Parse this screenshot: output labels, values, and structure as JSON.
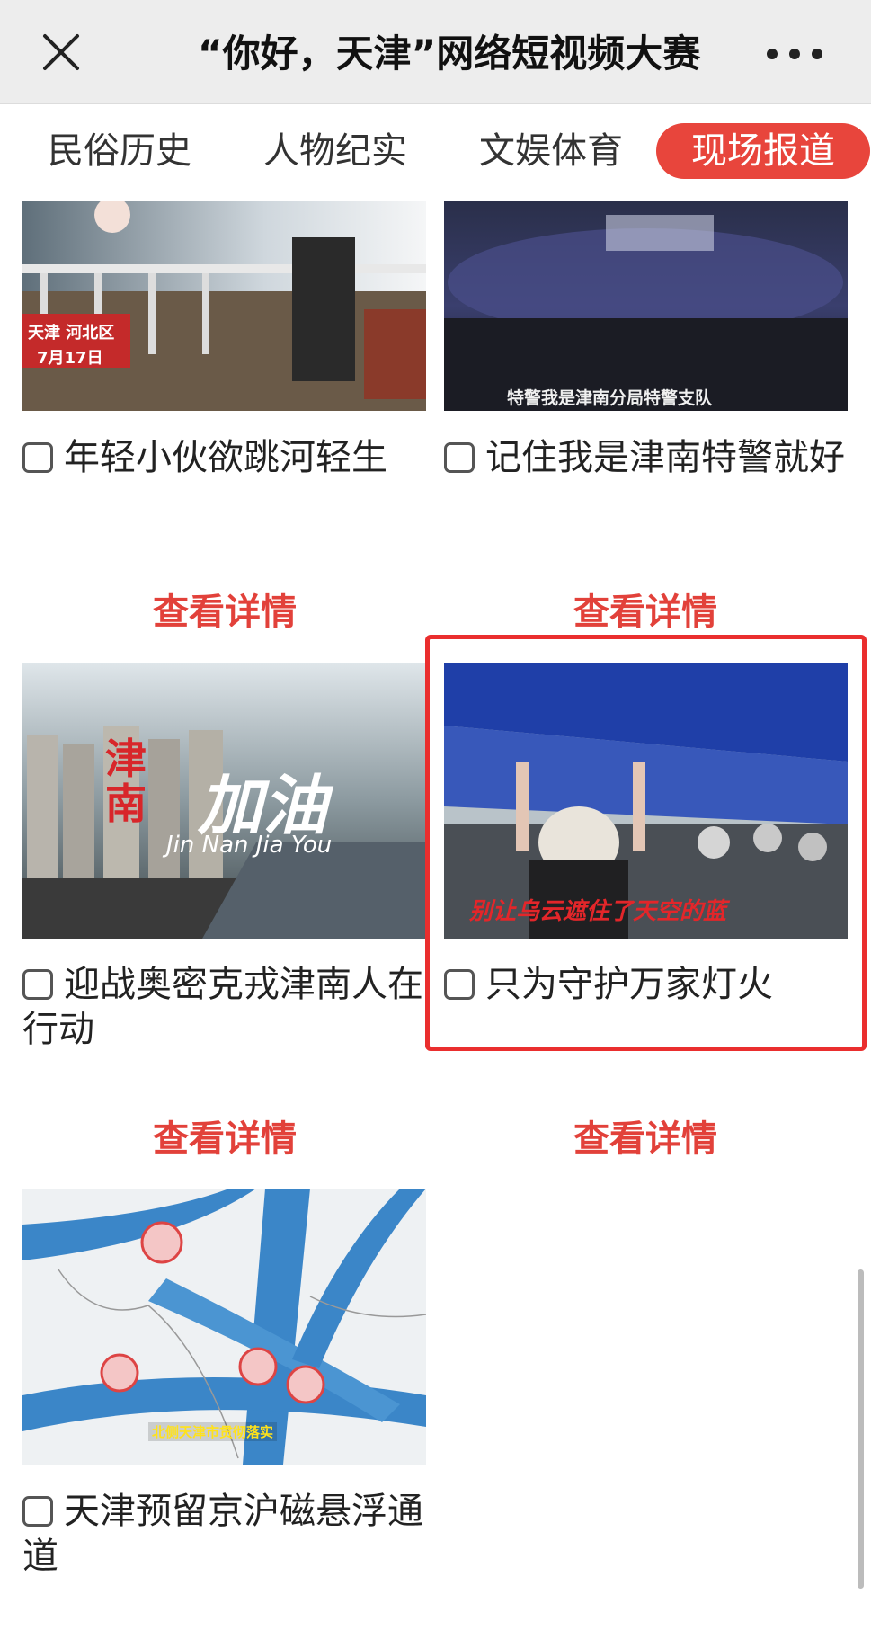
{
  "header": {
    "title": "“你好，天津”网络短视频大赛"
  },
  "tabs": [
    "民俗历史",
    "人物纪实",
    "文娱体育",
    "现场报道"
  ],
  "active_tab": "现场报道",
  "detail_label": "查看详情",
  "cards": [
    {
      "caption": "年轻小伙欲跳河轻生",
      "overlay": [
        "天津 河北区",
        "7月17日"
      ]
    },
    {
      "caption": "记住我是津南特警就好",
      "overlay": [
        "特警我是津南分局特警支队"
      ]
    },
    {
      "caption": "迎战奥密克戎津南人在行动",
      "overlay": [
        "津南",
        "加油",
        "Jin Nan Jia You"
      ]
    },
    {
      "caption": "只为守护万家灯火",
      "overlay": [
        "别让乌云遮住了天空的蓝"
      ]
    },
    {
      "caption": "天津预留京沪磁悬浮通道",
      "overlay": [
        "北侧天津市贯彻落实"
      ]
    }
  ],
  "colors": {
    "accent": "#e8453c",
    "highlight": "#ea2e2e",
    "header_bg": "#ededed"
  }
}
